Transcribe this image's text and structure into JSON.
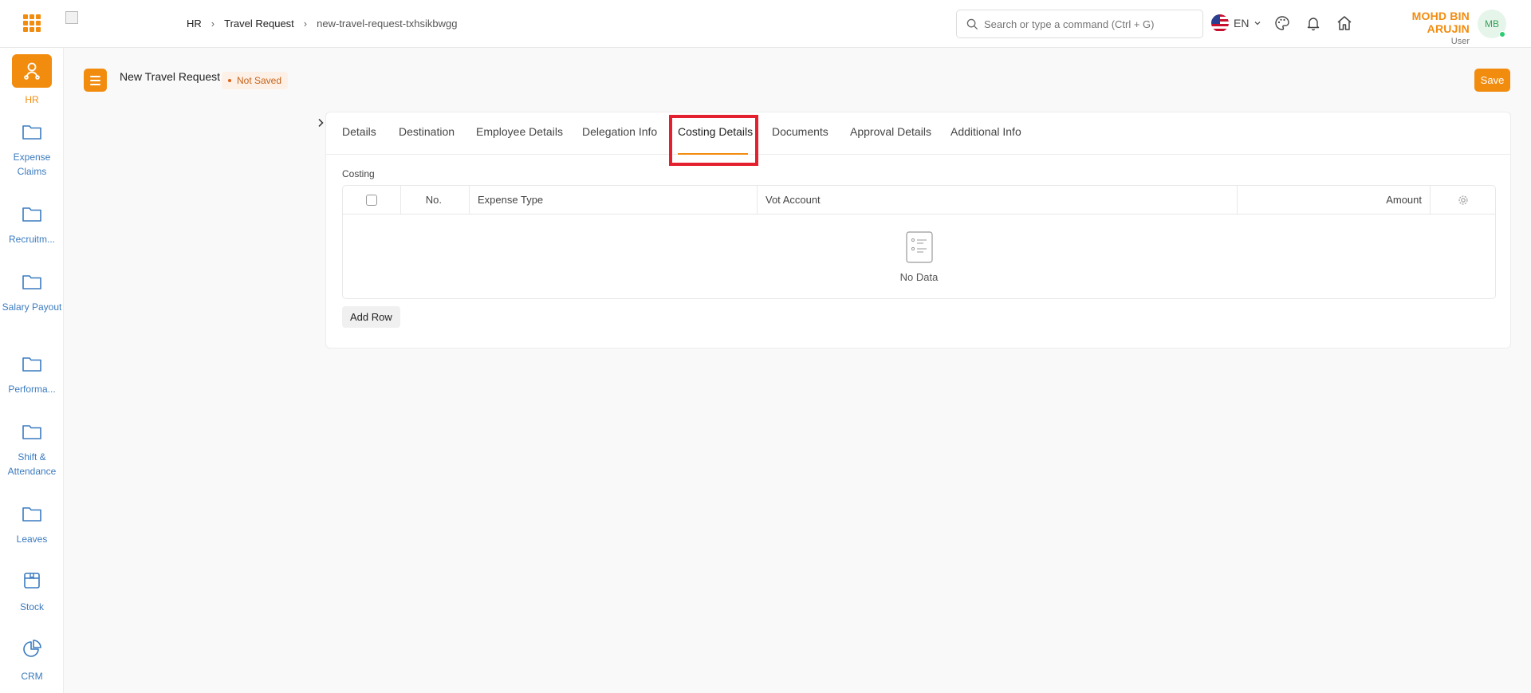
{
  "header": {
    "breadcrumbs": [
      "HR",
      "Travel Request",
      "new-travel-request-txhsikbwgg"
    ],
    "search_placeholder": "Search or type a command (Ctrl + G)",
    "language": "EN",
    "user_name": "MOHD BIN ARUJIN",
    "user_role": "User",
    "avatar_initials": "MB"
  },
  "sidebar": {
    "items": [
      {
        "label": "HR",
        "icon": "hr-icon",
        "active": true
      },
      {
        "label": "Expense Claims",
        "icon": "folder-icon"
      },
      {
        "label": "Recruitm...",
        "icon": "folder-icon"
      },
      {
        "label": "Salary Payout",
        "icon": "folder-icon"
      },
      {
        "label": "Performa...",
        "icon": "folder-icon"
      },
      {
        "label": "Shift & Attendance",
        "icon": "folder-icon"
      },
      {
        "label": "Leaves",
        "icon": "folder-icon"
      },
      {
        "label": "Stock",
        "icon": "box-icon"
      },
      {
        "label": "CRM",
        "icon": "pie-chart-icon"
      }
    ]
  },
  "page": {
    "title": "New Travel Request",
    "status": "Not Saved",
    "save_label": "Save"
  },
  "tabs": [
    {
      "label": "Details"
    },
    {
      "label": "Destination"
    },
    {
      "label": "Employee Details"
    },
    {
      "label": "Delegation Info"
    },
    {
      "label": "Costing Details",
      "active": true
    },
    {
      "label": "Documents"
    },
    {
      "label": "Approval Details"
    },
    {
      "label": "Additional Info"
    }
  ],
  "costing": {
    "section_label": "Costing",
    "columns": [
      "No.",
      "Expense Type",
      "Vot Account",
      "Amount"
    ],
    "empty_text": "No Data",
    "add_row_label": "Add Row"
  },
  "colors": {
    "accent": "#f28c0f",
    "link_blue": "#3b7bbf",
    "highlight_red": "#e5202e"
  }
}
